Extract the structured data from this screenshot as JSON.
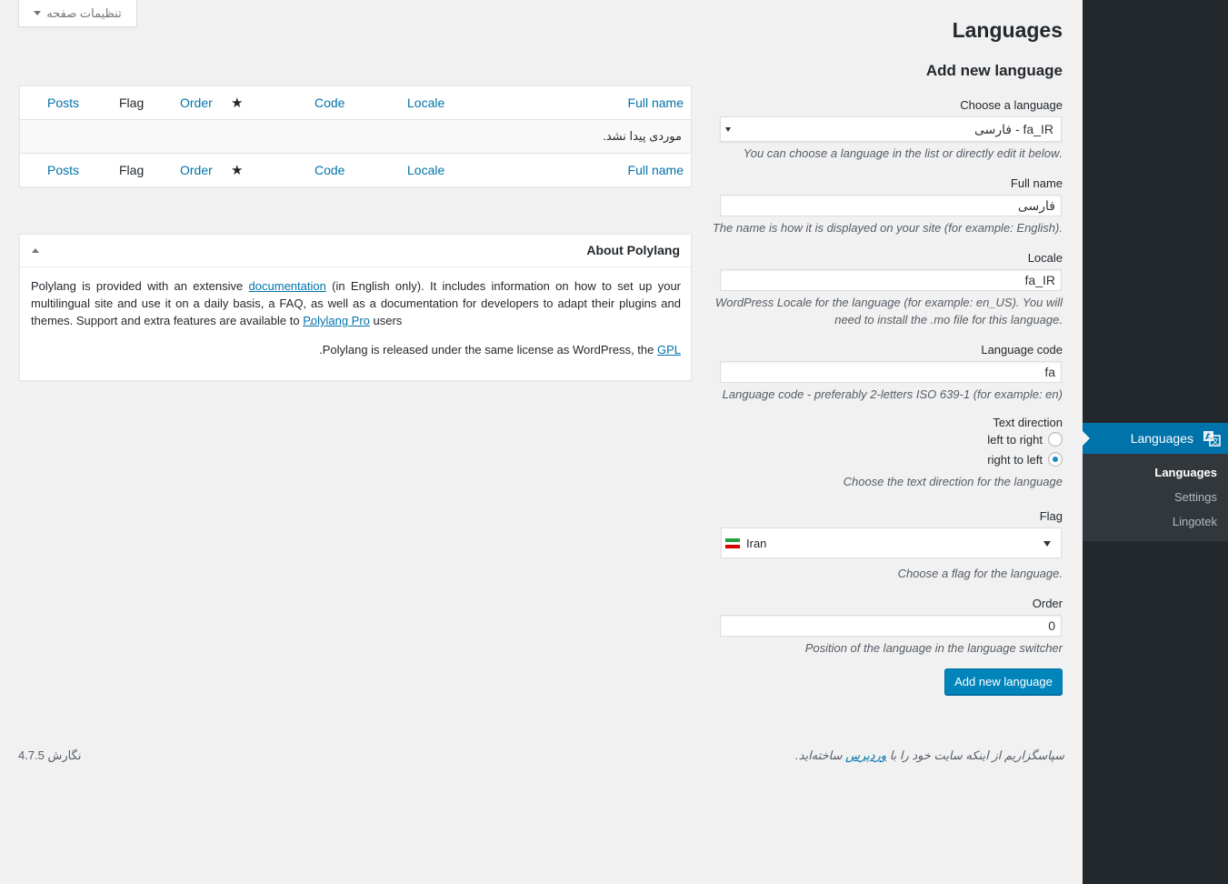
{
  "screen_options": {
    "label": "تنظیمات صفحه"
  },
  "header": {
    "title": "Languages",
    "form_title": "Add new language"
  },
  "form": {
    "choose_language": {
      "label": "Choose a language",
      "value": "فارسی - fa_IR",
      "description": ".You can choose a language in the list or directly edit it below"
    },
    "full_name": {
      "label": "Full name",
      "value": "فارسی",
      "description": ".(The name is how it is displayed on your site (for example: English"
    },
    "locale": {
      "label": "Locale",
      "value": "fa_IR",
      "description_line1": "WordPress Locale for the language (for example: en_US). You will",
      "description_line2": ".need to install the .mo file for this language"
    },
    "language_code": {
      "label": "Language code",
      "value": "fa",
      "description": "(Language code - preferably 2-letters ISO 639-1 (for example: en"
    },
    "text_direction": {
      "label": "Text direction",
      "options": [
        {
          "label": "left to right",
          "checked": false
        },
        {
          "label": "right to left",
          "checked": true
        }
      ],
      "description": "Choose the text direction for the language"
    },
    "flag": {
      "label": "Flag",
      "value": "Iran",
      "description": ".Choose a flag for the language"
    },
    "order": {
      "label": "Order",
      "value": "0",
      "description": "Position of the language in the language switcher"
    },
    "submit_label": "Add new language"
  },
  "table": {
    "columns": {
      "full_name": "Full name",
      "locale": "Locale",
      "code": "Code",
      "order": "Order",
      "flag": "Flag",
      "posts": "Posts"
    },
    "empty_message": "موردی پیدا نشد."
  },
  "about": {
    "title": "About Polylang",
    "p1_a": "Polylang is provided with an extensive ",
    "p1_link1": "documentation",
    "p1_b": " (in English only). It includes information on how to set up your multilingual site and use it on a daily basis, a FAQ, as well as a documentation for developers to adapt their plugins and themes. Support and extra features are available to ",
    "p1_link2": "Polylang Pro",
    "p1_c": " users",
    "p1_end": ".",
    "p2_a": "Polylang is released under the same license as WordPress, the ",
    "p2_link": "GPL",
    "p2_end": "."
  },
  "sidebar": {
    "menu_title": "Languages",
    "items": [
      {
        "label": "Languages",
        "current": true
      },
      {
        "label": "Settings",
        "current": false
      },
      {
        "label": "Lingotek",
        "current": false
      }
    ]
  },
  "footer": {
    "thanks_a": "سپاسگزاریم از اینکه سایت خود را با ",
    "thanks_link": "وردپرس",
    "thanks_b": " ساخته‌اید.",
    "version": "نگارش 4.7.5"
  },
  "colors": {
    "accent": "#0073aa",
    "button": "#0085ba",
    "sidebar_bg": "#23282d",
    "submenu_bg": "#32373c"
  }
}
